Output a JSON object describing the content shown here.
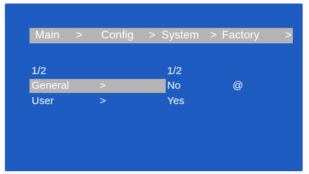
{
  "breadcrumb": {
    "items": [
      "Main",
      "Config",
      "System",
      "Factory"
    ],
    "separator": ">"
  },
  "left_menu": {
    "page": "1/2",
    "items": [
      {
        "label": "General",
        "arrow": ">",
        "selected": true
      },
      {
        "label": "User",
        "arrow": ">",
        "selected": false
      }
    ]
  },
  "right_menu": {
    "page": "1/2",
    "items": [
      {
        "label": "No",
        "marker": "@"
      },
      {
        "label": "Yes"
      }
    ]
  },
  "colors": {
    "screen_bg": "#1f5cc1",
    "highlight_bg": "#b4b4b4",
    "text": "#ffffff"
  }
}
